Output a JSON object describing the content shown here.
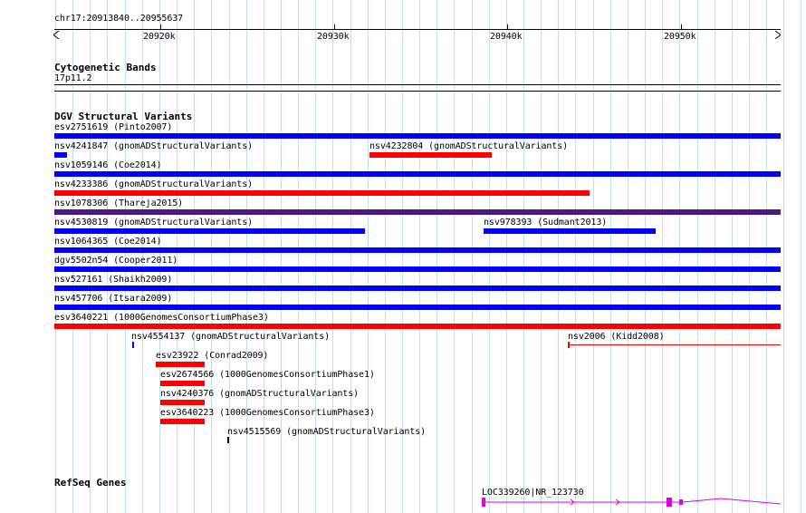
{
  "ruler": {
    "coordinates": "chr17:20913840..20955637",
    "ticks": [
      "20920k",
      "20930k",
      "20940k",
      "20950k"
    ]
  },
  "cytobands": {
    "title": "Cytogenetic Bands",
    "band": "17p11.2"
  },
  "dgv": {
    "title": "DGV Structural Variants",
    "features": [
      {
        "label": "esv2751619 (Pinto2007)",
        "color": "#0000ff"
      },
      {
        "label": "nsv4241847 (gnomADStructuralVariants)",
        "color": "#0000ff"
      },
      {
        "label": "nsv4232804 (gnomADStructuralVariants)",
        "color": "#ff0000"
      },
      {
        "label": "nsv1059146 (Coe2014)",
        "color": "#0000ff"
      },
      {
        "label": "nsv4233386 (gnomADStructuralVariants)",
        "color": "#ff0000"
      },
      {
        "label": "nsv1078306 (Thareja2015)",
        "color": "#4b1a80"
      },
      {
        "label": "nsv4530819 (gnomADStructuralVariants)",
        "color": "#0000ff"
      },
      {
        "label": "nsv978393 (Sudmant2013)",
        "color": "#0000ff"
      },
      {
        "label": "nsv1064365 (Coe2014)",
        "color": "#0000ff"
      },
      {
        "label": "dgv5502n54 (Cooper2011)",
        "color": "#0000ff"
      },
      {
        "label": "nsv527161 (Shaikh2009)",
        "color": "#0000ff"
      },
      {
        "label": "nsv457706 (Itsara2009)",
        "color": "#0000ff"
      },
      {
        "label": "esv3640221 (1000GenomesConsortiumPhase3)",
        "color": "#ff0000"
      },
      {
        "label": "nsv4554137 (gnomADStructuralVariants)",
        "color": "#0000ff"
      },
      {
        "label": "nsv2006 (Kidd2008)",
        "color": "#ff0000"
      },
      {
        "label": "esv23922 (Conrad2009)",
        "color": "#ff0000"
      },
      {
        "label": "esv2674566 (1000GenomesConsortiumPhase1)",
        "color": "#ff0000"
      },
      {
        "label": "nsv4240376 (gnomADStructuralVariants)",
        "color": "#ff0000"
      },
      {
        "label": "esv3640223 (1000GenomesConsortiumPhase3)",
        "color": "#ff0000"
      },
      {
        "label": "nsv4515569 (gnomADStructuralVariants)",
        "color": "#000000"
      }
    ]
  },
  "refseq": {
    "title": "RefSeq Genes",
    "gene": "LOC339260|NR_123730",
    "color": "#e000e0"
  }
}
